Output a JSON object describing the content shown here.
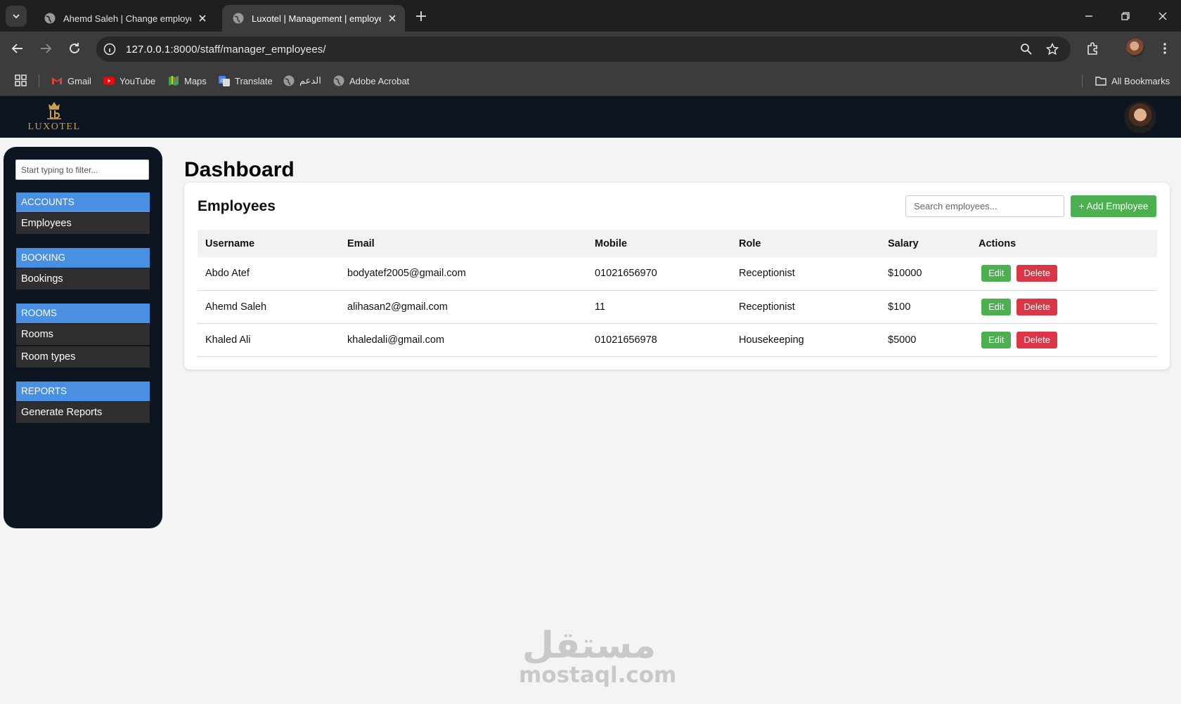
{
  "browser": {
    "tabs": [
      {
        "title": "Ahemd Saleh | Change employee |",
        "active": false
      },
      {
        "title": "Luxotel | Management | employee",
        "active": true
      }
    ],
    "url_host": "127.0.0.1",
    "url_rest": ":8000/staff/manager_employees/",
    "bookmarks": [
      "Gmail",
      "YouTube",
      "Maps",
      "Translate",
      "الدعم",
      "Adobe Acrobat"
    ],
    "all_bookmarks": "All Bookmarks"
  },
  "header": {
    "logo_text": "LUXOTEL"
  },
  "sidebar": {
    "filter_placeholder": "Start typing to filter...",
    "sections": [
      {
        "title": "ACCOUNTS",
        "items": [
          "Employees"
        ]
      },
      {
        "title": "BOOKING",
        "items": [
          "Bookings"
        ]
      },
      {
        "title": "ROOMS",
        "items": [
          "Rooms",
          "Room types"
        ]
      },
      {
        "title": "REPORTS",
        "items": [
          "Generate Reports"
        ]
      }
    ]
  },
  "main": {
    "page_title": "Dashboard",
    "card_title": "Employees",
    "search_placeholder": "Search employees...",
    "add_button": "+ Add Employee",
    "columns": [
      "Username",
      "Email",
      "Mobile",
      "Role",
      "Salary",
      "Actions"
    ],
    "rows": [
      {
        "username": "Abdo Atef",
        "email": "bodyatef2005@gmail.com",
        "mobile": "01021656970",
        "role": "Receptionist",
        "salary": "$10000"
      },
      {
        "username": "Ahemd Saleh",
        "email": "alihasan2@gmail.com",
        "mobile": "11",
        "role": "Receptionist",
        "salary": "$100"
      },
      {
        "username": "Khaled Ali",
        "email": "khaledali@gmail.com",
        "mobile": "01021656978",
        "role": "Housekeeping",
        "salary": "$5000"
      }
    ],
    "edit_label": "Edit",
    "delete_label": "Delete"
  },
  "watermark": {
    "arabic": "مستقل",
    "latin": "mostaql.com"
  },
  "colors": {
    "section_blue": "#4a90e2",
    "edit_green": "#4caf50",
    "delete_red": "#dc3545",
    "navy": "#0d1521"
  }
}
